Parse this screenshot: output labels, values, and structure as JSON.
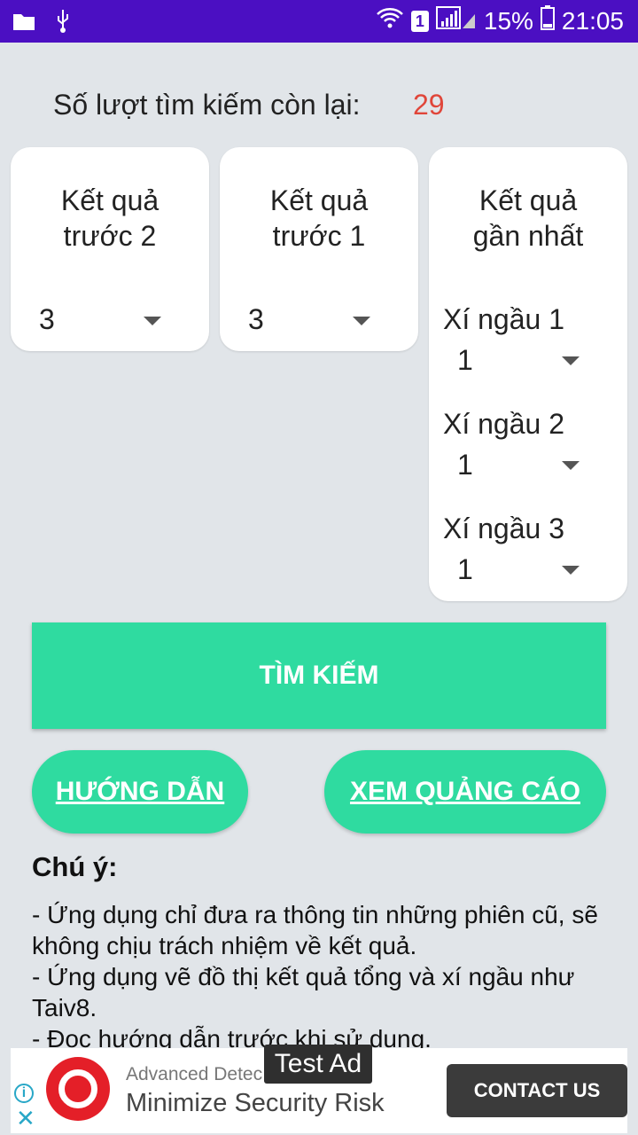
{
  "status_bar": {
    "battery": "15%",
    "time": "21:05",
    "sim_badge": "1",
    "icons": [
      "folder-icon",
      "usb-icon",
      "wifi-icon",
      "signal-icon",
      "battery-icon"
    ]
  },
  "counter": {
    "label": "Số lượt tìm kiếm còn lại:",
    "value": "29"
  },
  "cards": {
    "prev2": {
      "title_line1": "Kết quả",
      "title_line2": "trước 2",
      "value": "3"
    },
    "prev1": {
      "title_line1": "Kết quả",
      "title_line2": "trước 1",
      "value": "3"
    },
    "latest": {
      "title_line1": "Kết quả",
      "title_line2": "gần nhất",
      "dice": [
        {
          "label": "Xí ngầu 1",
          "value": "1"
        },
        {
          "label": "Xí ngầu 2",
          "value": "1"
        },
        {
          "label": "Xí ngầu 3",
          "value": "1"
        }
      ]
    }
  },
  "actions": {
    "search_label": "TÌM KIẾM",
    "guide_label": "HƯỚNG DẪN",
    "watch_ad_label": "XEM QUẢNG CÁO"
  },
  "notes": {
    "title": "Chú ý:",
    "lines": [
      "- Ứng dụng chỉ đưa ra thông tin những phiên cũ, sẽ không chịu trách nhiệm về kết quả.",
      "- Ứng dụng vẽ đồ thị kết quả tổng và xí ngầu như Taiv8.",
      "- Đọc hướng dẫn trước khi sử dụng."
    ]
  },
  "ad": {
    "badge": "Test Ad",
    "small_text": "Advanced Detec",
    "headline": "Minimize Security Risk",
    "cta": "CONTACT US",
    "info_glyph": "i",
    "close_glyph": "✕"
  },
  "colors": {
    "status_bar": "#4b0fc2",
    "accent_green": "#2fdba0",
    "counter_value": "#e0463a",
    "background": "#e1e5e9"
  }
}
